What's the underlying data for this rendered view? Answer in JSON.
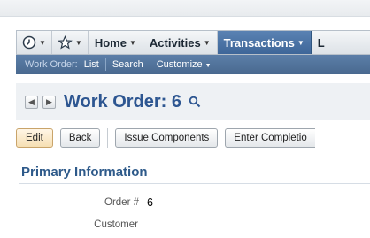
{
  "navbar": {
    "recent_icon": "clock-icon",
    "favorites_icon": "star-icon",
    "items": [
      {
        "label": "Home"
      },
      {
        "label": "Activities"
      },
      {
        "label": "Transactions"
      },
      {
        "label": "L"
      }
    ],
    "active_color": "#4a72a5"
  },
  "subbar": {
    "record_type": "Work Order:",
    "list": "List",
    "search": "Search",
    "customize": "Customize"
  },
  "titlebar": {
    "title": "Work Order: 6",
    "prev_icon": "triangle-left-icon",
    "next_icon": "triangle-right-icon",
    "search_icon": "magnifier-icon"
  },
  "buttons": {
    "edit": "Edit",
    "back": "Back",
    "issue_components": "Issue Components",
    "enter_completion": "Enter Completio"
  },
  "section": {
    "title": "Primary Information"
  },
  "fields": {
    "order_label": "Order #",
    "order_value": "6",
    "customer_label": "Customer"
  },
  "colors": {
    "title_blue": "#2d5691",
    "subbar_blue": "#52749e",
    "edit_button": "#f6dfb3"
  }
}
